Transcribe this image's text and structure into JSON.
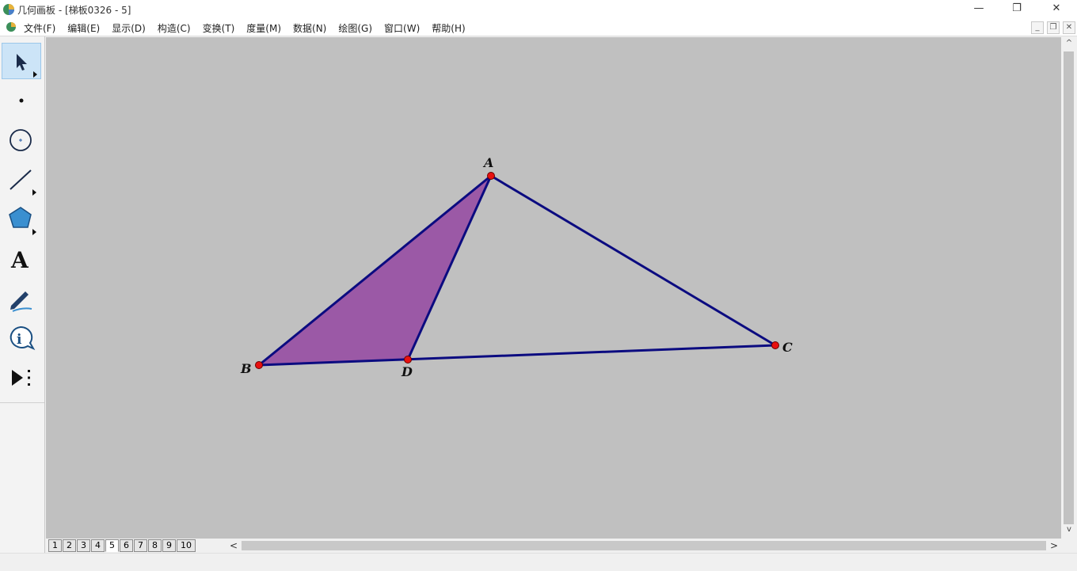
{
  "window": {
    "title": "几何画板 - [梯板0326 - 5]",
    "minimize_glyph": "—",
    "restore_glyph": "❐",
    "close_glyph": "✕"
  },
  "menu": {
    "items": [
      "文件(F)",
      "编辑(E)",
      "显示(D)",
      "构造(C)",
      "变换(T)",
      "度量(M)",
      "数据(N)",
      "绘图(G)",
      "窗口(W)",
      "帮助(H)"
    ],
    "mdi_minimize": "_",
    "mdi_restore": "❐",
    "mdi_close": "✕"
  },
  "toolbox": {
    "tools": [
      {
        "name": "arrow-select-tool",
        "icon": "arrow-icon",
        "selected": true
      },
      {
        "name": "point-tool",
        "icon": "point-icon",
        "selected": false
      },
      {
        "name": "compass-tool",
        "icon": "circle-icon",
        "selected": false
      },
      {
        "name": "straightedge-tool",
        "icon": "line-icon",
        "selected": false
      },
      {
        "name": "polygon-tool",
        "icon": "pentagon-icon",
        "selected": false
      },
      {
        "name": "text-tool",
        "icon": "text-a-icon",
        "selected": false
      },
      {
        "name": "marker-tool",
        "icon": "pen-icon",
        "selected": false
      },
      {
        "name": "information-tool",
        "icon": "info-icon",
        "selected": false
      },
      {
        "name": "custom-tool",
        "icon": "play-more-icon",
        "selected": false
      }
    ],
    "text_tool_glyph": "A"
  },
  "figure": {
    "points": [
      {
        "label": "A"
      },
      {
        "label": "B"
      },
      {
        "label": "C"
      },
      {
        "label": "D"
      }
    ],
    "segments": [
      "AB",
      "AC",
      "BC",
      "AD"
    ],
    "shaded_polygon": "ABD",
    "colors": {
      "canvas": "#c0c0c0",
      "segment": "#0b0b80",
      "fill": "#9b59a6",
      "point": "#e81010"
    }
  },
  "pages": {
    "tabs": [
      "1",
      "2",
      "3",
      "4",
      "5",
      "6",
      "7",
      "8",
      "9",
      "10"
    ],
    "active": "5",
    "scroll_left": "<",
    "scroll_right": ">"
  },
  "scrollbar": {
    "up": "^",
    "down": "v"
  }
}
